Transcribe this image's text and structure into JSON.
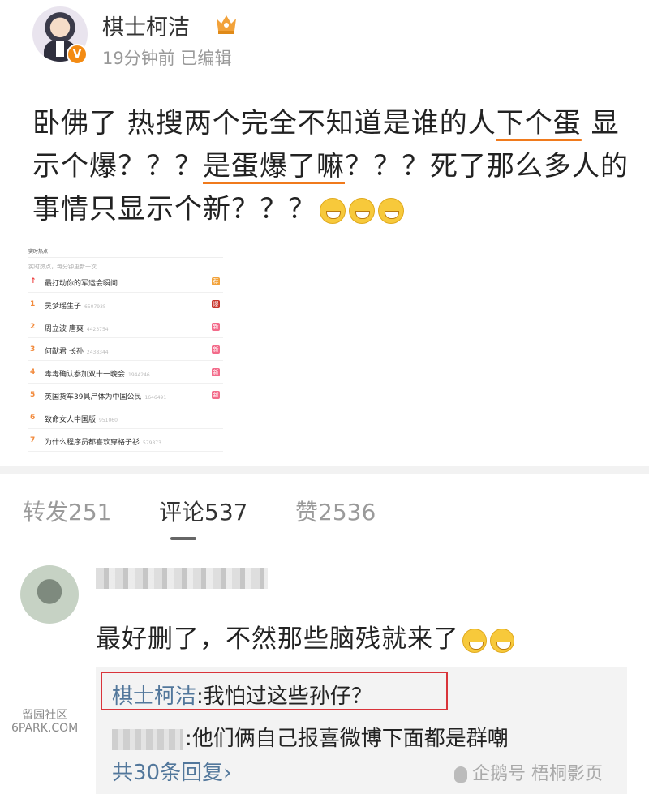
{
  "post": {
    "author": "棋士柯洁",
    "meta": "19分钟前 已编辑",
    "verified_badge": "V",
    "text_parts": [
      "卧佛了 热搜两个完全不知道是谁的人",
      "下个蛋",
      " 显示个爆？？？",
      "是蛋爆了嘛",
      "？？？死了那么多人的事情只显示个新？？？"
    ],
    "underline_color": "#f07a1c"
  },
  "hot_search": {
    "tabs": [
      "实时热点",
      "",
      "",
      "",
      ""
    ],
    "subtitle": "实时热点，每分钟更新一次",
    "rows": [
      {
        "rank": "↑",
        "title": "最打动你的军运会瞬间",
        "count": "",
        "badge": "荐",
        "badge_color": "#f2a23a"
      },
      {
        "rank": "1",
        "title": "吴梦瑶生子",
        "count": "6507935",
        "badge": "爆",
        "badge_color": "#c8362d"
      },
      {
        "rank": "2",
        "title": "周立波 唐爽",
        "count": "4423754",
        "badge": "新",
        "badge_color": "#f36b8a"
      },
      {
        "rank": "3",
        "title": "何猷君 长孙",
        "count": "2438344",
        "badge": "新",
        "badge_color": "#f36b8a"
      },
      {
        "rank": "4",
        "title": "毒毒确认参加双十一晚会",
        "count": "1944246",
        "badge": "新",
        "badge_color": "#f36b8a"
      },
      {
        "rank": "5",
        "title": "英国货车39具尸体为中国公民",
        "count": "1646491",
        "badge": "新",
        "badge_color": "#f36b8a"
      },
      {
        "rank": "6",
        "title": "致命女人中国版",
        "count": "951060",
        "badge": "",
        "badge_color": ""
      },
      {
        "rank": "7",
        "title": "为什么程序员都喜欢穿格子衫",
        "count": "579873",
        "badge": "",
        "badge_color": ""
      }
    ]
  },
  "tabs": {
    "repost": "转发251",
    "comments": "评论537",
    "likes": "赞2536"
  },
  "comment": {
    "text": "最好删了，不然那些脑残就来了",
    "replies": [
      {
        "name": "棋士柯洁",
        "text": ":我怕过这些孙仔？"
      },
      {
        "name": "",
        "text": ":他们俩自己报喜微博下面都是群嘲"
      }
    ],
    "more": "共30条回复",
    "more_icon": "chevron-right-icon"
  },
  "watermarks": {
    "left_top": "留园社区",
    "left_bottom": "6PARK.COM",
    "right": "企鹅号 梧桐影页"
  }
}
